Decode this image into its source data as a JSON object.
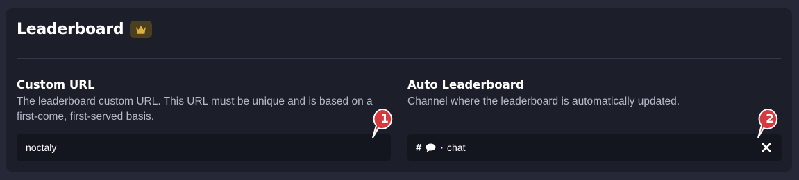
{
  "header": {
    "title": "Leaderboard",
    "premium_badge_icon": "crown-icon",
    "badge_color": "#e0b13a"
  },
  "custom_url": {
    "label": "Custom URL",
    "description": "The leaderboard custom URL. This URL must be unique and is based on a first-come, first-served basis.",
    "value": "noctaly"
  },
  "auto_leaderboard": {
    "label": "Auto Leaderboard",
    "description": "Channel where the leaderboard is automatically updated.",
    "channel": {
      "prefix": "#",
      "emoji_icon": "speech-bubble-icon",
      "separator": "·",
      "name": "chat"
    },
    "clear_icon": "close-icon"
  },
  "annotations": [
    {
      "number": "1",
      "color": "#e0393e"
    },
    {
      "number": "2",
      "color": "#e0393e"
    }
  ]
}
